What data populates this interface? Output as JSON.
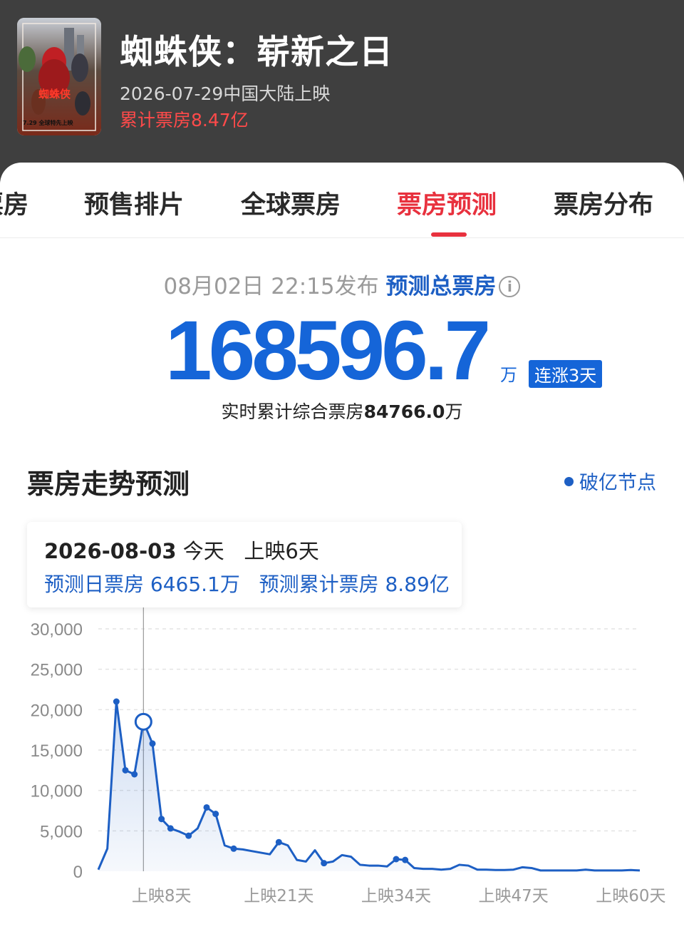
{
  "movie": {
    "title": "蜘蛛侠：崭新之日",
    "release": "2026-07-29中国大陆上映",
    "cumulative_box": "累计票房8.47亿",
    "poster_caption": "7.29 全球特先上映"
  },
  "tabs": [
    {
      "label": "票房"
    },
    {
      "label": "预售排片"
    },
    {
      "label": "全球票房"
    },
    {
      "label": "票房预测",
      "active": true
    },
    {
      "label": "票房分布"
    }
  ],
  "forecast": {
    "publish_time": "08月02日 22:15发布",
    "label": "预测总票房",
    "info_icon": "i",
    "total": "168596.7",
    "unit": "万",
    "trend_badge": "连涨3天",
    "realtime_prefix": "实时累计综合票房",
    "realtime_value": "84766.0",
    "realtime_unit": "万"
  },
  "section": {
    "title": "票房走势预测",
    "legend": "破亿节点"
  },
  "tooltip": {
    "date": "2026-08-03",
    "today": "今天",
    "day": "上映6天",
    "daily": "预测日票房 6465.1万",
    "cumulative": "预测累计票房 8.89亿"
  },
  "chart_data": {
    "type": "area",
    "ylim": [
      0,
      30000
    ],
    "yticks": [
      "30,000",
      "25,000",
      "20,000",
      "15,000",
      "10,000",
      "5,000",
      "0"
    ],
    "ytick_values": [
      30000,
      25000,
      20000,
      15000,
      10000,
      5000,
      0
    ],
    "xtick_labels": [
      "上映8天",
      "上映21天",
      "上映34天",
      "上映47天",
      "上映60天"
    ],
    "xtick_days": [
      8,
      21,
      34,
      47,
      60
    ],
    "highlight_day": 6,
    "series": [
      {
        "x": [
          1,
          2,
          3,
          4,
          5,
          6,
          7,
          8,
          9,
          10,
          11,
          12,
          13,
          14,
          15,
          16,
          17,
          18,
          19,
          20,
          21,
          22,
          23,
          24,
          25,
          26,
          27,
          28,
          29,
          30,
          31,
          32,
          33,
          34,
          35,
          36,
          37,
          38,
          39,
          40,
          41,
          42,
          43,
          44,
          45,
          46,
          47,
          48,
          49,
          50,
          51,
          52,
          53,
          54,
          55,
          56,
          57,
          58,
          59,
          60,
          61
        ],
        "values": [
          200,
          2800,
          21000,
          12500,
          12000,
          18500,
          15800,
          6465,
          5300,
          4900,
          4400,
          5300,
          7900,
          7100,
          3200,
          2800,
          2700,
          2500,
          2300,
          2100,
          3600,
          3200,
          1400,
          1200,
          2600,
          1000,
          1200,
          2000,
          1800,
          800,
          700,
          700,
          600,
          1500,
          1400,
          400,
          300,
          300,
          200,
          300,
          800,
          700,
          200,
          200,
          150,
          150,
          200,
          500,
          400,
          100,
          100,
          100,
          100,
          100,
          200,
          100,
          100,
          100,
          100,
          150,
          100
        ]
      }
    ],
    "marked_days": [
      3,
      4,
      5,
      6,
      7,
      8,
      9,
      11,
      13,
      14,
      16,
      21,
      26,
      34,
      35
    ],
    "color": "#1d5fc4"
  }
}
